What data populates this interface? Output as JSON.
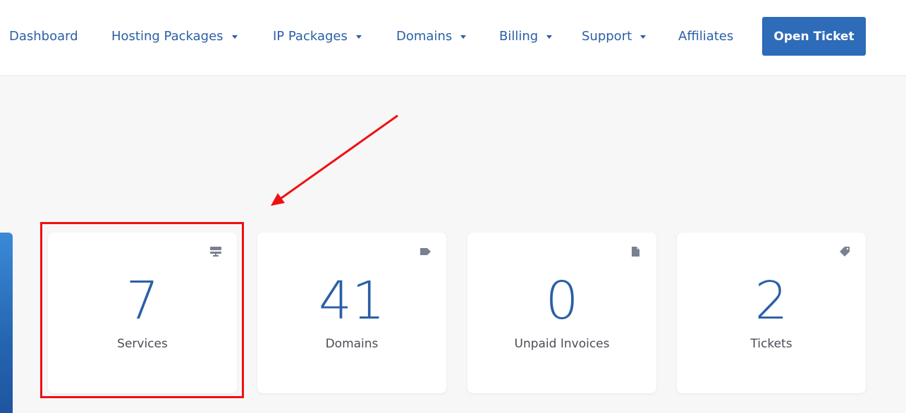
{
  "nav": {
    "dashboard": "Dashboard",
    "hosting": "Hosting Packages",
    "ip": "IP Packages",
    "domains": "Domains",
    "billing": "Billing",
    "support": "Support",
    "affiliates": "Affiliates",
    "open_ticket": "Open Ticket"
  },
  "tiles": [
    {
      "value": "7",
      "label": "Services",
      "icon": "server-icon"
    },
    {
      "value": "41",
      "label": "Domains",
      "icon": "tag-icon"
    },
    {
      "value": "0",
      "label": "Unpaid Invoices",
      "icon": "file-icon"
    },
    {
      "value": "2",
      "label": "Tickets",
      "icon": "ticket-icon"
    }
  ],
  "colors": {
    "accent": "#2b5fa6",
    "button": "#2e6bb8",
    "highlight": "#ee1111",
    "icon": "#7a8092"
  }
}
